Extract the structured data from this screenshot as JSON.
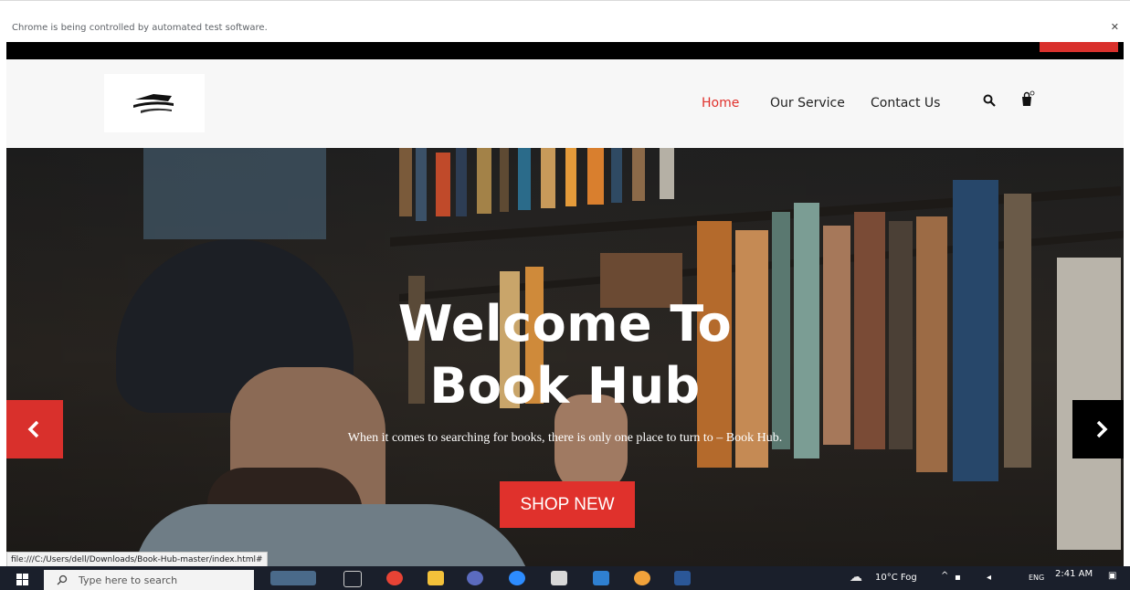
{
  "browser": {
    "infobar_message": "Chrome is being controlled by automated test software.",
    "status_url": "file:///C:/Users/dell/Downloads/Book-Hub-master/index.html#"
  },
  "header": {
    "nav": [
      {
        "label": "Home",
        "active": true
      },
      {
        "label": "Our Service",
        "active": false
      },
      {
        "label": "Contact Us",
        "active": false
      }
    ],
    "icons": [
      "search-icon",
      "shopping-bag-icon"
    ]
  },
  "hero": {
    "title_line1": "Welcome To",
    "title_line2": "Book Hub",
    "subtitle": "When it comes to searching for books, there is only one place to turn to – Book Hub.",
    "button_label": "SHOP NEW",
    "prev_icon": "chevron-left-icon",
    "next_icon": "chevron-right-icon"
  },
  "taskbar": {
    "search_placeholder": "Type here to search",
    "weather": "10°C Fog",
    "language": "ENG",
    "time": "2:41 AM"
  },
  "colors": {
    "accent": "#e0312c",
    "nav_text": "#222222",
    "top_strip": "#000000"
  }
}
